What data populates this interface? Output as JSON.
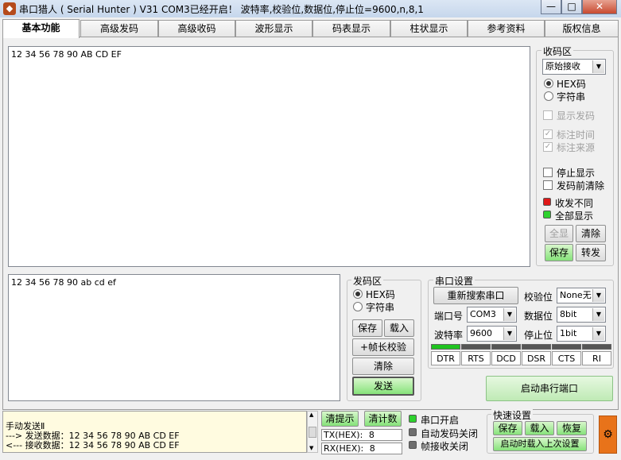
{
  "window": {
    "title": "串口猎人 ( Serial Hunter ) V31     COM3已经开启！ 波特率,校验位,数据位,停止位=9600,n,8,1",
    "minimize": "—",
    "maximize": "□",
    "close": "✕"
  },
  "tabs": [
    "基本功能",
    "高级发码",
    "高级收码",
    "波形显示",
    "码表显示",
    "柱状显示",
    "参考资料",
    "版权信息"
  ],
  "receive_area": {
    "content": "12 34 56 78 90 AB CD EF"
  },
  "send_area": {
    "content": "12 34 56 78 90 ab cd ef"
  },
  "recv_panel": {
    "title": "收码区",
    "mode_select": "原始接收",
    "radio_hex": "HEX码",
    "radio_text": "字符串",
    "chk_show_send": "显示发码",
    "chk_mark_time": "标注时间",
    "chk_mark_source": "标注来源",
    "chk_stop_display": "停止显示",
    "chk_clear_before": "发码前清除",
    "led_diff": "收发不同",
    "led_all": "全部显示",
    "btn_full": "全显",
    "btn_clear": "清除",
    "btn_save": "保存",
    "btn_forward": "转发"
  },
  "send_panel": {
    "title": "发码区",
    "radio_hex": "HEX码",
    "radio_text": "字符串",
    "btn_save": "保存",
    "btn_load": "载入",
    "btn_frame_check": "+帧长校验",
    "btn_clear": "清除",
    "btn_send": "发送"
  },
  "port_settings": {
    "title": "串口设置",
    "btn_rescan": "重新搜索串口",
    "parity_label": "校验位",
    "parity_value": "None无",
    "port_label": "端口号",
    "port_value": "COM3",
    "databits_label": "数据位",
    "databits_value": "8bit",
    "baud_label": "波特率",
    "baud_value": "9600",
    "stopbits_label": "停止位",
    "stopbits_value": "1bit",
    "signals": [
      "DTR",
      "RTS",
      "DCD",
      "DSR",
      "CTS",
      "RI"
    ],
    "btn_open": "启动串行端口"
  },
  "status": {
    "log_lines": [
      "手动发送Ⅱ",
      "---> 发送数据：12 34 56 78 90 AB CD EF",
      "<--- 接收数据：12 34 56 78 90 AB CD EF"
    ],
    "btn_clear_tips": "清提示",
    "btn_clear_counts": "清计数",
    "tx_label": "TX(HEX):",
    "tx_value": "8",
    "rx_label": "RX(HEX):",
    "rx_value": "8",
    "led_port_open": "串口开启",
    "led_auto_send_off": "自动发码关闭",
    "led_frame_recv_off": "帧接收关闭",
    "quick_settings": "快速设置",
    "qs_save": "保存",
    "qs_load": "载入",
    "qs_restore": "恢复",
    "qs_autoload": "启动时载入上次设置"
  },
  "colors": {
    "led_green": "#2ed12e",
    "led_red": "#e01818",
    "led_gray": "#6e6e6e",
    "accent_orange": "#e8731a"
  }
}
